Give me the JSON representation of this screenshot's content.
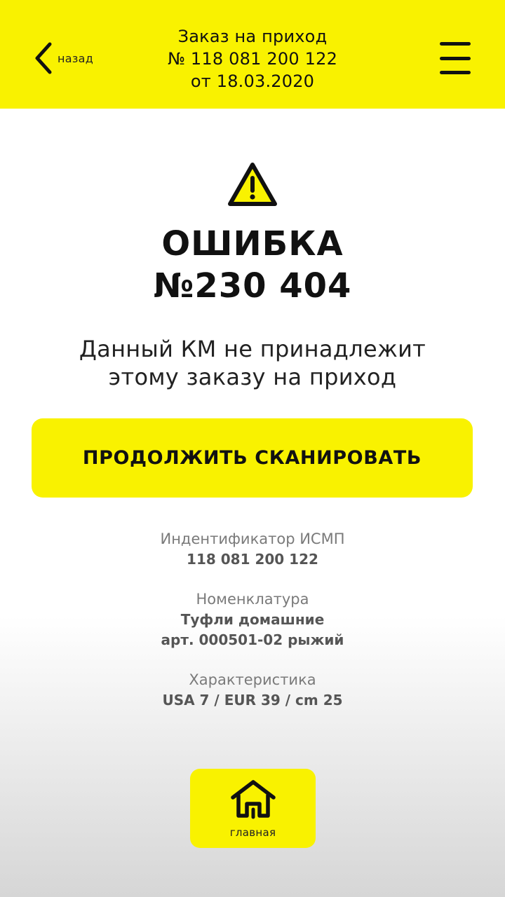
{
  "header": {
    "back_label": "назад",
    "title_line1": "Заказ на приход",
    "title_line2": "№ 118 081 200 122",
    "title_line3": "от 18.03.2020"
  },
  "error": {
    "title_line1": "ОШИБКА",
    "title_line2": "№230 404",
    "message_line1": "Данный КМ не принадлежит",
    "message_line2": "этому заказу на приход"
  },
  "actions": {
    "continue_label": "ПРОДОЛЖИТЬ СКАНИРОВАТЬ"
  },
  "details": {
    "id_label": "Индентификатор ИСМП",
    "id_value": "118 081 200 122",
    "nomenclature_label": "Номенклатура",
    "nomenclature_line1": "Туфли домашние",
    "nomenclature_line2": "арт. 000501-02 рыжий",
    "characteristic_label": "Характеристика",
    "characteristic_value": "USA 7 / EUR 39 / cm 25"
  },
  "footer": {
    "home_label": "главная"
  },
  "icons": [
    "chevron-left-icon",
    "hamburger-menu-icon",
    "warning-icon",
    "home-icon"
  ],
  "colors": {
    "accent": "#f9f200",
    "text": "#111111",
    "muted": "#7a7a7a"
  }
}
